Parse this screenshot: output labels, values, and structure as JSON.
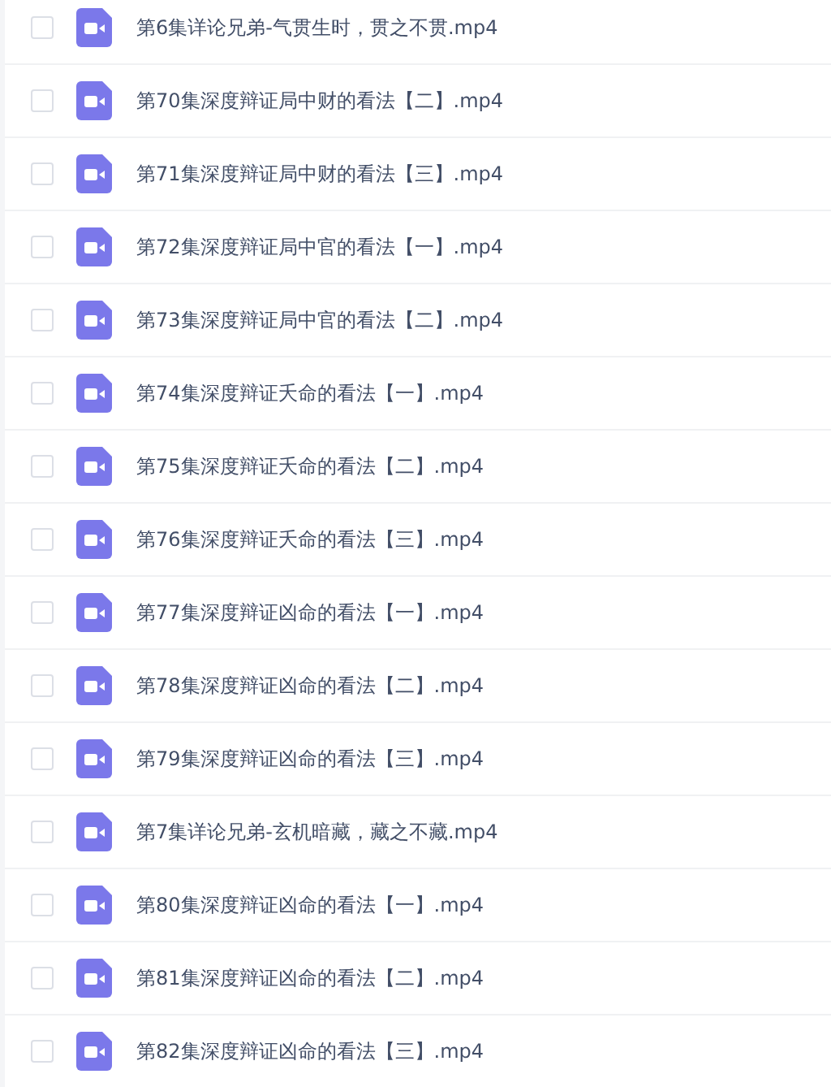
{
  "files": [
    {
      "name": "第6集详论兄弟-气贯生时，贯之不贯.mp4",
      "checked": false
    },
    {
      "name": "第70集深度辩证局中财的看法【二】.mp4",
      "checked": false
    },
    {
      "name": "第71集深度辩证局中财的看法【三】.mp4",
      "checked": false
    },
    {
      "name": "第72集深度辩证局中官的看法【一】.mp4",
      "checked": false
    },
    {
      "name": "第73集深度辩证局中官的看法【二】.mp4",
      "checked": false
    },
    {
      "name": "第74集深度辩证夭命的看法【一】.mp4",
      "checked": false
    },
    {
      "name": "第75集深度辩证夭命的看法【二】.mp4",
      "checked": false
    },
    {
      "name": "第76集深度辩证夭命的看法【三】.mp4",
      "checked": false
    },
    {
      "name": "第77集深度辩证凶命的看法【一】.mp4",
      "checked": false
    },
    {
      "name": "第78集深度辩证凶命的看法【二】.mp4",
      "checked": false
    },
    {
      "name": "第79集深度辩证凶命的看法【三】.mp4",
      "checked": false
    },
    {
      "name": "第7集详论兄弟-玄机暗藏，藏之不藏.mp4",
      "checked": false
    },
    {
      "name": "第80集深度辩证凶命的看法【一】.mp4",
      "checked": false
    },
    {
      "name": "第81集深度辩证凶命的看法【二】.mp4",
      "checked": false
    },
    {
      "name": "第82集深度辩证凶命的看法【三】.mp4",
      "checked": false
    }
  ]
}
